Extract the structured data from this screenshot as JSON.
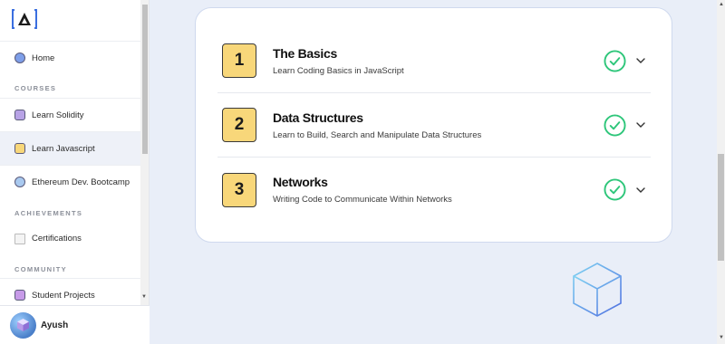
{
  "sidebar": {
    "home": {
      "label": "Home"
    },
    "sections": {
      "courses": "COURSES",
      "achievements": "ACHIEVEMENTS",
      "community": "COMMUNITY"
    },
    "courses": [
      {
        "label": "Learn Solidity",
        "color": "#b8a3e6"
      },
      {
        "label": "Learn Javascript",
        "color": "#f8d77a"
      },
      {
        "label": "Ethereum Dev. Bootcamp",
        "color": "#a9c9ef"
      }
    ],
    "achievements": [
      {
        "label": "Certifications"
      }
    ],
    "community": [
      {
        "label": "Student Projects",
        "color": "#c79be8"
      }
    ]
  },
  "user": {
    "name": "Ayush"
  },
  "lessons": [
    {
      "number": "1",
      "title": "The Basics",
      "subtitle": "Learn Coding Basics in JavaScript",
      "completed": true
    },
    {
      "number": "2",
      "title": "Data Structures",
      "subtitle": "Learn to Build, Search and Manipulate Data Structures",
      "completed": true
    },
    {
      "number": "3",
      "title": "Networks",
      "subtitle": "Writing Code to Communicate Within Networks",
      "completed": true
    }
  ],
  "colors": {
    "accent_check": "#2ec67a",
    "number_box": "#f8d77a",
    "page_bg": "#e9eef8",
    "logo_blue": "#3b6fe0"
  }
}
